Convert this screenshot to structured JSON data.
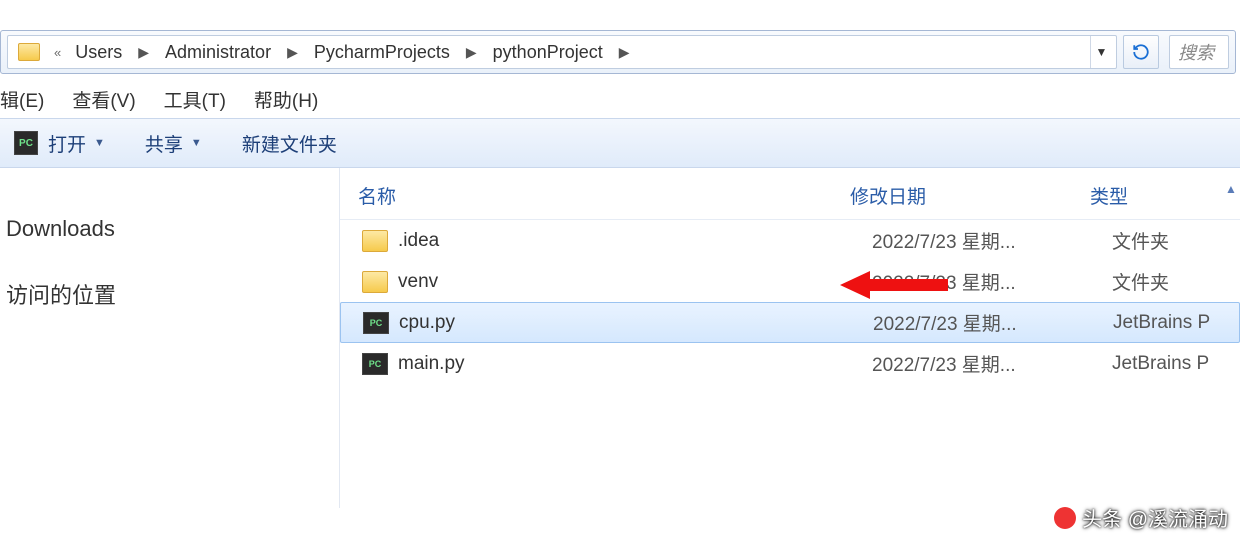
{
  "breadcrumb": {
    "prefix": "«",
    "items": [
      "Users",
      "Administrator",
      "PycharmProjects",
      "pythonProject"
    ]
  },
  "search": {
    "placeholder": "搜索"
  },
  "menu": {
    "edit": "辑(E)",
    "view": "查看(V)",
    "tools": "工具(T)",
    "help": "帮助(H)"
  },
  "toolbar": {
    "open": "打开",
    "share": "共享",
    "new_folder": "新建文件夹"
  },
  "nav": {
    "downloads": "Downloads",
    "recent": "访问的位置"
  },
  "columns": {
    "name": "名称",
    "modified": "修改日期",
    "type": "类型"
  },
  "files": [
    {
      "name": ".idea",
      "date": "2022/7/23 星期...",
      "type": "文件夹",
      "icon": "folder",
      "selected": false
    },
    {
      "name": "venv",
      "date": "2022/7/23 星期...",
      "type": "文件夹",
      "icon": "folder",
      "selected": false
    },
    {
      "name": "cpu.py",
      "date": "2022/7/23 星期...",
      "type": "JetBrains P",
      "icon": "pc",
      "selected": true
    },
    {
      "name": "main.py",
      "date": "2022/7/23 星期...",
      "type": "JetBrains P",
      "icon": "pc",
      "selected": false
    }
  ],
  "watermark": "头条 @溪流涌动"
}
